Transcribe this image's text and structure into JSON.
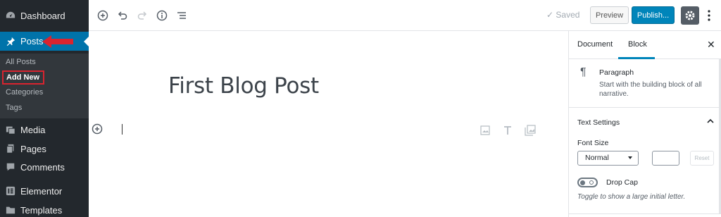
{
  "sidebar": {
    "dashboard": "Dashboard",
    "posts": "Posts",
    "posts_submenu": [
      "All Posts",
      "Add New",
      "Categories",
      "Tags"
    ],
    "media": "Media",
    "pages": "Pages",
    "comments": "Comments",
    "elementor": "Elementor",
    "templates": "Templates"
  },
  "toolbar": {
    "saved": "Saved",
    "preview": "Preview",
    "publish": "Publish..."
  },
  "editor": {
    "title": "First Blog Post"
  },
  "panel": {
    "tabs": [
      "Document",
      "Block"
    ],
    "active_tab": "Block",
    "block_name": "Paragraph",
    "block_desc": "Start with the building block of all narrative.",
    "text_settings": "Text Settings",
    "font_size_label": "Font Size",
    "font_size_value": "Normal",
    "reset": "Reset",
    "drop_cap": "Drop Cap",
    "drop_cap_help": "Toggle to show a large initial letter."
  },
  "colors": {
    "sidebar_bg": "#23282d",
    "active_menu": "#0073aa",
    "publish": "#0085ba",
    "highlight": "#d9242f"
  }
}
